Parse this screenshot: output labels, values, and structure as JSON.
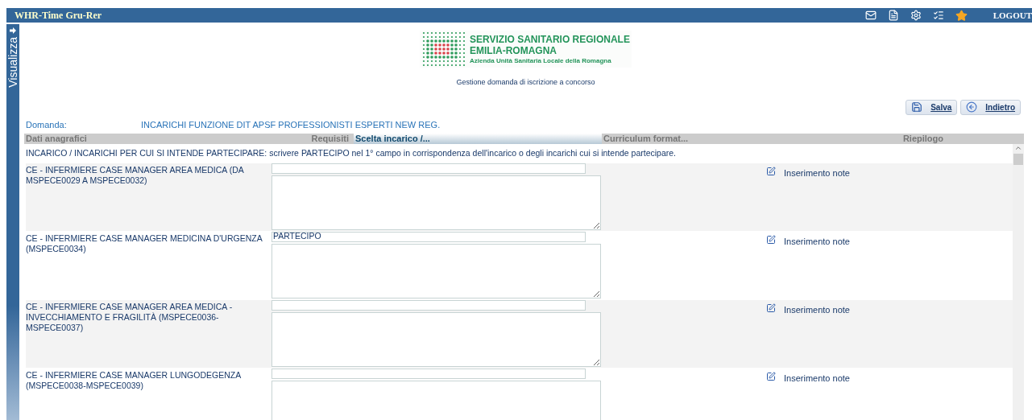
{
  "topbar": {
    "title": "WHR-Time Gru-Rer",
    "logout": "LOGOUT"
  },
  "sidebar": {
    "label": "Visualizza"
  },
  "logo": {
    "line1": "SERVIZIO SANITARIO REGIONALE",
    "line2": "EMILIA-ROMAGNA",
    "line3": "Azienda Unità Sanitaria Locale della Romagna"
  },
  "subtitle": "Gestione domanda di iscrizione a concorso",
  "buttons": [
    {
      "kind": "save",
      "label": "Salva"
    },
    {
      "kind": "back",
      "label": "Indietro"
    }
  ],
  "domanda": {
    "label": "Domanda:",
    "value": "INCARICHI FUNZIONE DIT APSF PROFESSIONISTI ESPERTI NEW REG."
  },
  "tabs": [
    {
      "label": "Dati anagrafici",
      "selected": false
    },
    {
      "label": "Requisiti",
      "selected": false
    },
    {
      "label": "Scelta incarico /...",
      "selected": true
    },
    {
      "label": "Curriculum format...",
      "selected": false
    },
    {
      "label": "Riepilogo",
      "selected": false
    }
  ],
  "instruction": "INCARICO / INCARICHI PER CUI SI INTENDE PARTECIPARE: scrivere PARTECIPO nel 1° campo in corrispondenza dell'incarico o degli incarichi cui si intende partecipare.",
  "rows": [
    {
      "label": "CE - INFERMIERE CASE MANAGER AREA MEDICA (DA MSPECE0029 A MSPECE0032)",
      "note": "Inserimento note"
    },
    {
      "label": "CE - INFERMIERE CASE MANAGER MEDICINA D'URGENZA (MSPECE0034)",
      "value": "PARTECIPO",
      "note": "Inserimento note"
    },
    {
      "label": "CE - INFERMIERE CASE MANAGER AREA MEDICA - INVECCHIAMENTO E FRAGILITÀ (MSPECE0036-MSPECE0037)",
      "note": "Inserimento note"
    },
    {
      "label": "CE - INFERMIERE CASE MANAGER LUNGODEGENZA (MSPECE0038-MSPECE0039)",
      "note": "Inserimento note"
    }
  ]
}
